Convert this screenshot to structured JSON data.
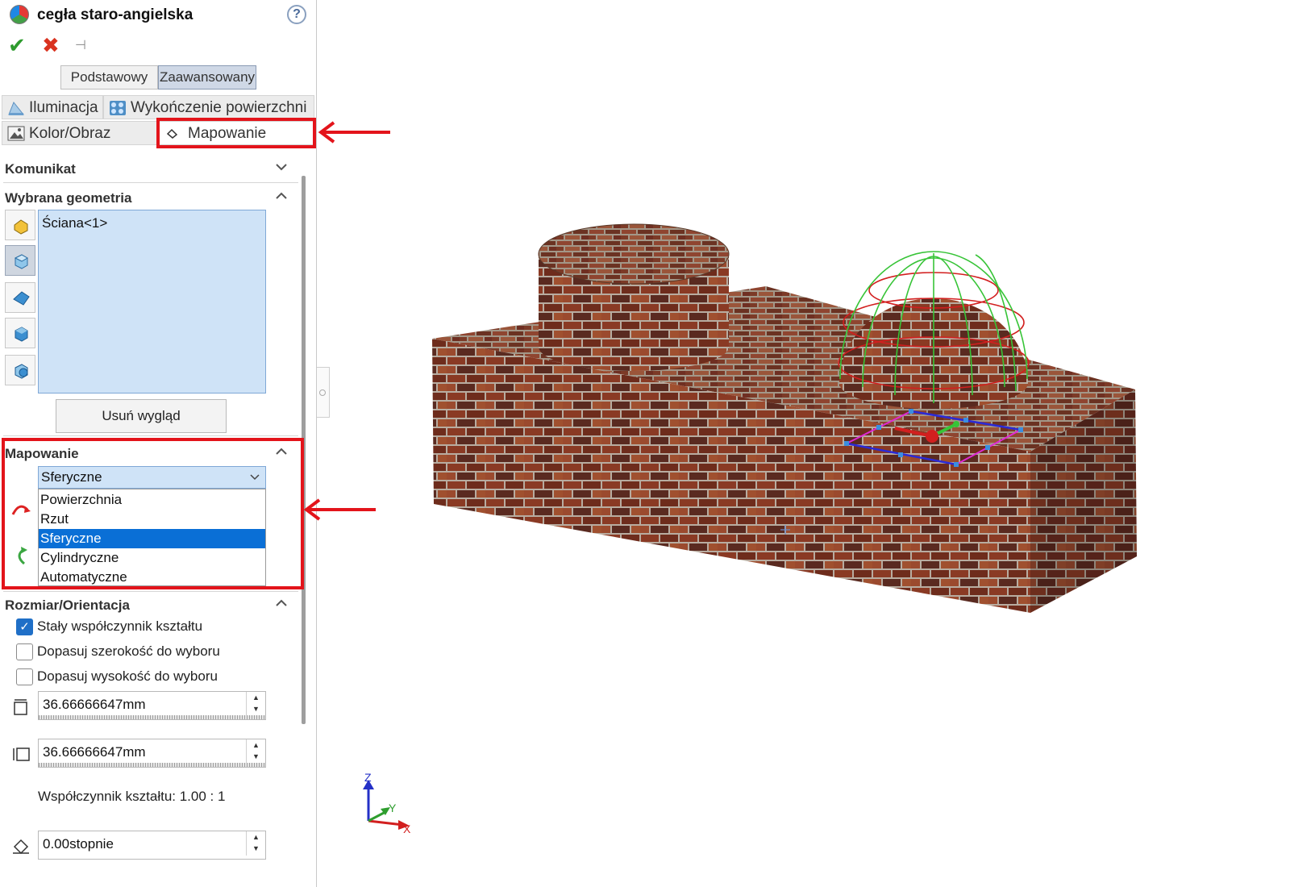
{
  "panel": {
    "title": "cegła staro-angielska",
    "help_icon": "?",
    "icons": [
      "appearance-ball-icon",
      "ok-check-icon",
      "cancel-x-icon",
      "pin-icon"
    ],
    "mode_tabs": {
      "basic": "Podstawowy",
      "advanced": "Zaawansowany",
      "active": "Zaawansowany"
    },
    "tabs": [
      {
        "label": "Iluminacja",
        "icon": "illumination-icon"
      },
      {
        "label": "Wykończenie powierzchni",
        "icon": "surface-finish-icon"
      },
      {
        "label": "Kolor/Obraz",
        "icon": "color-image-icon"
      },
      {
        "label": "Mapowanie",
        "icon": "mapping-icon",
        "active": true
      }
    ],
    "sections": {
      "message": {
        "title": "Komunikat",
        "collapsed": true
      },
      "geometry": {
        "title": "Wybrana geometria",
        "items": [
          "Ściana<1>"
        ],
        "filter_icons": [
          "part-filter-icon",
          "face-filter-icon",
          "feature-filter-icon",
          "body-filter-icon",
          "component-filter-icon"
        ],
        "remove_button": "Usuń wygląd"
      },
      "mapping": {
        "title": "Mapowanie",
        "selected": "Sferyczne",
        "options": [
          "Powierzchnia",
          "Rzut",
          "Sferyczne",
          "Cylindryczne",
          "Automatyczne"
        ]
      },
      "size": {
        "title": "Rozmiar/Orientacja",
        "checkboxes": [
          {
            "label": "Stały współczynnik kształtu",
            "checked": true
          },
          {
            "label": "Dopasuj szerokość do wyboru",
            "checked": false
          },
          {
            "label": "Dopasuj wysokość do wyboru",
            "checked": false
          }
        ],
        "width": "36.66666647mm",
        "height": "36.66666647mm",
        "aspect_text": "Współczynnik kształtu: 1.00 : 1",
        "rotation": "0.00stopnie"
      }
    }
  },
  "viewport": {
    "triad": {
      "z": "Z",
      "y": "Y",
      "x": "X"
    },
    "colors": {
      "brick": "#7a3422",
      "mortar": "#b8aca0",
      "highlight": "#e3141b",
      "selected_option": "#0a6fd6"
    }
  }
}
